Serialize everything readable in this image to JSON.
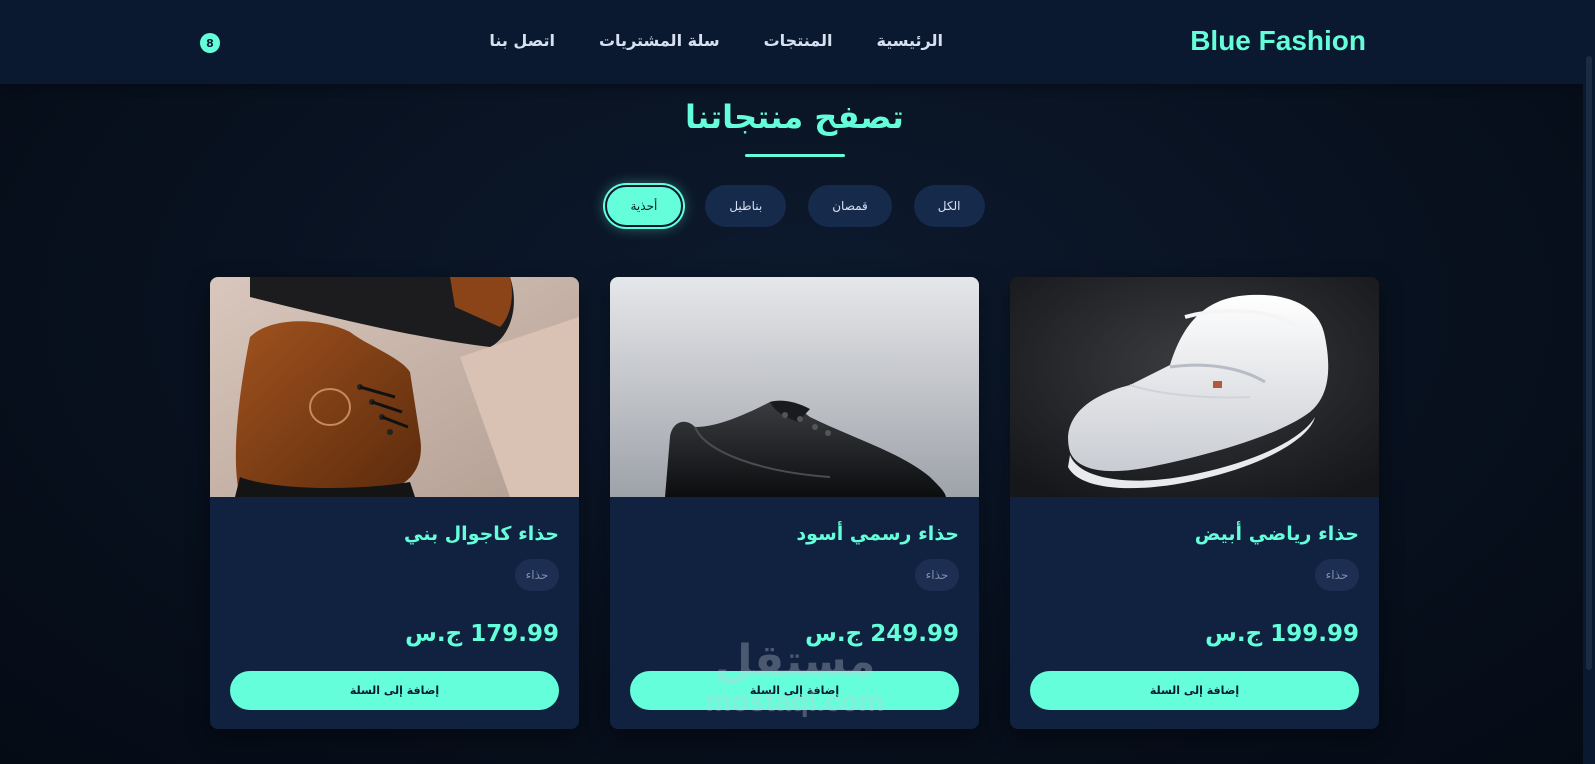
{
  "header": {
    "brand": "Blue Fashion",
    "nav": [
      "الرئيسية",
      "المنتجات",
      "سلة المشتريات",
      "اتصل بنا"
    ],
    "cart_count": "8"
  },
  "main": {
    "title": "تصفح منتجاتنا",
    "filters": [
      "الكل",
      "قمصان",
      "بناطيل",
      "أحذية"
    ],
    "active_filter": "أحذية",
    "products": [
      {
        "name": "حذاء رياضي أبيض",
        "tag": "حذاء",
        "price": "199.99 ج.س",
        "button": "إضافة إلى السلة",
        "image": "white-loafer-shoe"
      },
      {
        "name": "حذاء رسمي أسود",
        "tag": "حذاء",
        "price": "249.99 ج.س",
        "button": "إضافة إلى السلة",
        "image": "black-formal-shoe"
      },
      {
        "name": "حذاء كاجوال بني",
        "tag": "حذاء",
        "price": "179.99 ج.س",
        "button": "إضافة إلى السلة",
        "image": "brown-casual-boot"
      }
    ]
  },
  "watermark": {
    "logo": "مستقل",
    "text": "mostaql.com"
  },
  "colors": {
    "accent": "#64ffda",
    "navbar": "#0a1930",
    "card": "#112240",
    "text_light": "#d7e0f0"
  }
}
